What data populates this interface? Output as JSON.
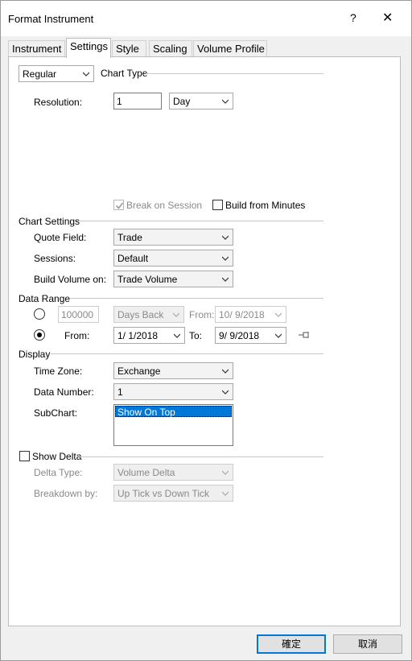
{
  "window": {
    "title": "Format Instrument",
    "help_icon": "?",
    "close_icon": "✕"
  },
  "tabs": [
    {
      "label": "Instrument",
      "active": false
    },
    {
      "label": "Settings",
      "active": true
    },
    {
      "label": "Style",
      "active": false
    },
    {
      "label": "Scaling",
      "active": false
    },
    {
      "label": "Volume Profile",
      "active": false
    }
  ],
  "chart_type": {
    "style_select": "Regular",
    "group_label": "Chart Type",
    "resolution_label": "Resolution:",
    "resolution_value": "1",
    "resolution_unit": "Day",
    "break_on_session_label": "Break on Session",
    "break_on_session_checked": true,
    "build_from_minutes_label": "Build from Minutes",
    "build_from_minutes_checked": false
  },
  "chart_settings": {
    "group_label": "Chart Settings",
    "quote_field_label": "Quote Field:",
    "quote_field_value": "Trade",
    "sessions_label": "Sessions:",
    "sessions_value": "Default",
    "build_volume_label": "Build Volume on:",
    "build_volume_value": "Trade Volume"
  },
  "data_range": {
    "group_label": "Data Range",
    "days_back_value": "100000",
    "days_back_unit": "Days Back",
    "from_label_disabled": "From:",
    "from_disabled_value": "10/ 9/2018",
    "from_label": "From:",
    "from_value": "1/ 1/2018",
    "to_label": "To:",
    "to_value": "9/ 9/2018",
    "selected_option": "from_to"
  },
  "display": {
    "group_label": "Display",
    "time_zone_label": "Time Zone:",
    "time_zone_value": "Exchange",
    "data_number_label": "Data Number:",
    "data_number_value": "1",
    "subchart_label": "SubChart:",
    "subchart_options": [
      "Show On Top"
    ]
  },
  "show_delta": {
    "label": "Show Delta",
    "checked": false,
    "delta_type_label": "Delta Type:",
    "delta_type_value": "Volume Delta",
    "breakdown_label": "Breakdown by:",
    "breakdown_value": "Up Tick vs Down Tick"
  },
  "buttons": {
    "ok": "確定",
    "cancel": "取消"
  },
  "colors": {
    "accent": "#0078d7",
    "panel": "#ffffff",
    "window": "#f0f0f0"
  }
}
